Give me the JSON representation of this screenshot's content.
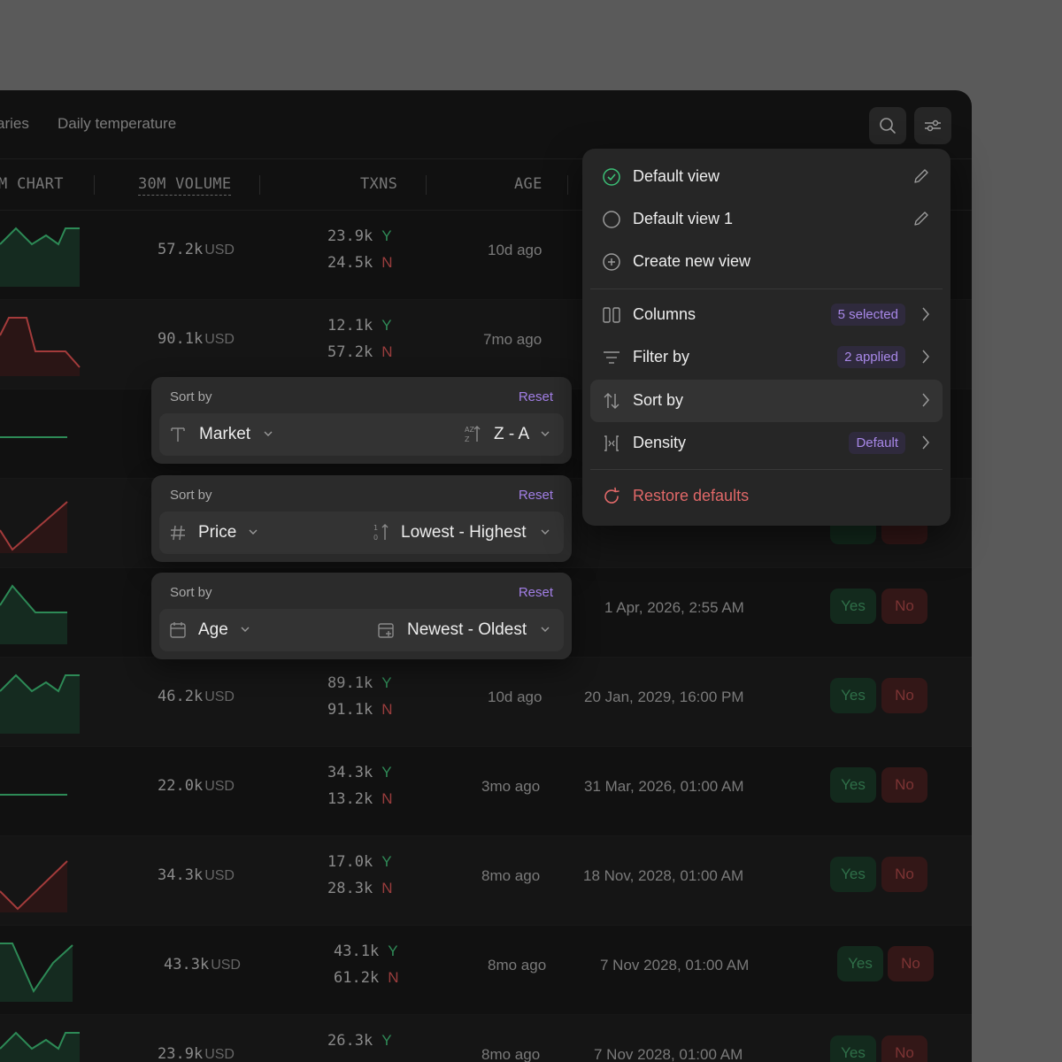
{
  "tabs": [
    "aries",
    "Daily temperature"
  ],
  "columns": [
    "M CHART",
    "30M VOLUME",
    "TXNS",
    "AGE"
  ],
  "rows": [
    {
      "vol": "57.2k",
      "unit": "USD",
      "ty": "23.9k",
      "tn": "24.5k",
      "y": "Y",
      "n": "N",
      "age": "10d ago",
      "date": "",
      "yes": "",
      "no": ""
    },
    {
      "vol": "90.1k",
      "unit": "USD",
      "ty": "12.1k",
      "tn": "57.2k",
      "y": "Y",
      "n": "N",
      "age": "7mo ago",
      "date": "",
      "yes": "",
      "no": ""
    },
    {
      "vol": "",
      "unit": "",
      "ty": "",
      "tn": "",
      "y": "",
      "n": "",
      "age": "",
      "date": "",
      "yes": "",
      "no": ""
    },
    {
      "vol": "",
      "unit": "",
      "ty": "",
      "tn": "",
      "y": "",
      "n": "",
      "age": "",
      "date": "",
      "yes": "",
      "no": ""
    },
    {
      "vol": "",
      "unit": "",
      "ty": "",
      "tn": "",
      "y": "",
      "n": "",
      "age": "",
      "date": "1 Apr, 2026, 2:55 AM",
      "yes": "Yes",
      "no": "No"
    },
    {
      "vol": "46.2k",
      "unit": "USD",
      "ty": "89.1k",
      "tn": "91.1k",
      "y": "Y",
      "n": "N",
      "age": "10d ago",
      "date": "20 Jan, 2029, 16:00 PM",
      "yes": "Yes",
      "no": "No"
    },
    {
      "vol": "22.0k",
      "unit": "USD",
      "ty": "34.3k",
      "tn": "13.2k",
      "y": "Y",
      "n": "N",
      "age": "3mo ago",
      "date": "31 Mar, 2026, 01:00 AM",
      "yes": "Yes",
      "no": "No"
    },
    {
      "vol": "34.3k",
      "unit": "USD",
      "ty": "17.0k",
      "tn": "28.3k",
      "y": "Y",
      "n": "N",
      "age": "8mo ago",
      "date": "18 Nov, 2028, 01:00 AM",
      "yes": "Yes",
      "no": "No"
    },
    {
      "vol": "43.3k",
      "unit": "USD",
      "ty": "43.1k",
      "tn": "61.2k",
      "y": "Y",
      "n": "N",
      "age": "8mo ago",
      "date": "7 Nov 2028, 01:00 AM",
      "yes": "Yes",
      "no": "No"
    },
    {
      "vol": "23.9k",
      "unit": "USD",
      "ty": "26.3k",
      "tn": "",
      "y": "Y",
      "n": "",
      "age": "8mo ago",
      "date": "7 Nov 2028, 01:00 AM",
      "yes": "Yes",
      "no": "No"
    }
  ],
  "sort_panels": [
    {
      "title": "Sort by",
      "reset": "Reset",
      "field": "Market",
      "order": "Z - A"
    },
    {
      "title": "Sort by",
      "reset": "Reset",
      "field": "Price",
      "order": "Lowest - Highest"
    },
    {
      "title": "Sort by",
      "reset": "Reset",
      "field": "Age",
      "order": "Newest - Oldest"
    }
  ],
  "menu": {
    "default_view": "Default view",
    "default_view_1": "Default view 1",
    "create_view": "Create new view",
    "columns": "Columns",
    "columns_badge": "5 selected",
    "filter": "Filter by",
    "filter_badge": "2 applied",
    "sort": "Sort by",
    "density": "Density",
    "density_badge": "Default",
    "restore": "Restore defaults"
  },
  "colors": {
    "accent_purple": "#a27fe6",
    "green": "#2f8a57",
    "red": "#9a3d3d",
    "danger": "#e06868"
  }
}
